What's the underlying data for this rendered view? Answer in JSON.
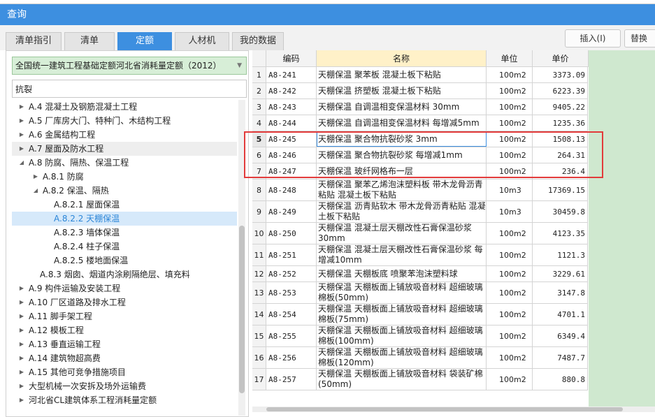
{
  "window": {
    "title": "查询"
  },
  "tabs": [
    {
      "label": "清单指引"
    },
    {
      "label": "清单"
    },
    {
      "label": "定额",
      "active": true
    },
    {
      "label": "人材机"
    },
    {
      "label": "我的数据"
    }
  ],
  "toolbar": {
    "insert_label": "插入(I)",
    "replace_label": "替换"
  },
  "library": {
    "selected": "全国统一建筑工程基础定额河北省消耗量定额（2012）"
  },
  "search": {
    "value": "抗裂"
  },
  "tree": [
    {
      "label": "A.4 混凝土及钢筋混凝土工程",
      "level": 1,
      "expander": "collapsed"
    },
    {
      "label": "A.5 厂库房大门、特种门、木结构工程",
      "level": 1,
      "expander": "collapsed"
    },
    {
      "label": "A.6 金属结构工程",
      "level": 1,
      "expander": "collapsed"
    },
    {
      "label": "A.7 屋面及防水工程",
      "level": 1,
      "expander": "collapsed",
      "state": "current"
    },
    {
      "label": "A.8 防腐、隔热、保温工程",
      "level": 1,
      "expander": "expanded"
    },
    {
      "label": "A.8.1 防腐",
      "level": 2,
      "expander": "collapsed"
    },
    {
      "label": "A.8.2 保温、隔热",
      "level": 2,
      "expander": "expanded"
    },
    {
      "label": "A.8.2.1 屋面保温",
      "level": 3,
      "expander": "none"
    },
    {
      "label": "A.8.2.2 天棚保温",
      "level": 3,
      "expander": "none",
      "state": "selected"
    },
    {
      "label": "A.8.2.3 墙体保温",
      "level": 3,
      "expander": "none"
    },
    {
      "label": "A.8.2.4 柱子保温",
      "level": 3,
      "expander": "none"
    },
    {
      "label": "A.8.2.5 楼地面保温",
      "level": 3,
      "expander": "none"
    },
    {
      "label": "A.8.3 烟囱、烟道内涂刷隔绝层、填充料",
      "level": 2,
      "expander": "none"
    },
    {
      "label": "A.9 构件运输及安装工程",
      "level": 1,
      "expander": "collapsed"
    },
    {
      "label": "A.10 厂区道路及排水工程",
      "level": 1,
      "expander": "collapsed"
    },
    {
      "label": "A.11 脚手架工程",
      "level": 1,
      "expander": "collapsed"
    },
    {
      "label": "A.12 模板工程",
      "level": 1,
      "expander": "collapsed"
    },
    {
      "label": "A.13 垂直运输工程",
      "level": 1,
      "expander": "collapsed"
    },
    {
      "label": "A.14 建筑物超高费",
      "level": 1,
      "expander": "collapsed"
    },
    {
      "label": "A.15 其他可竞争措施项目",
      "level": 1,
      "expander": "collapsed"
    },
    {
      "label": "大型机械一次安拆及场外运输费",
      "level": 1,
      "expander": "collapsed"
    },
    {
      "label": "河北省CL建筑体系工程消耗量定额",
      "level": 1,
      "expander": "collapsed"
    }
  ],
  "grid": {
    "columns": {
      "code": "编码",
      "name": "名称",
      "unit": "单位",
      "price": "单价"
    },
    "rows": [
      {
        "idx": "1",
        "code": "A8-241",
        "name": "天棚保温 聚苯板 混凝土板下粘贴",
        "unit": "100m2",
        "price": "3373.09"
      },
      {
        "idx": "2",
        "code": "A8-242",
        "name": "天棚保温 挤塑板 混凝土板下粘贴",
        "unit": "100m2",
        "price": "6223.39"
      },
      {
        "idx": "3",
        "code": "A8-243",
        "name": "天棚保温 自调温相变保温材料 30mm",
        "unit": "100m2",
        "price": "9405.22"
      },
      {
        "idx": "4",
        "code": "A8-244",
        "name": "天棚保温 自调温相变保温材料 每增减5mm",
        "unit": "100m2",
        "price": "1235.36"
      },
      {
        "idx": "5",
        "code": "A8-245",
        "name": "天棚保温 聚合物抗裂砂浆 3mm",
        "unit": "100m2",
        "price": "1508.13",
        "current": true
      },
      {
        "idx": "6",
        "code": "A8-246",
        "name": "天棚保温 聚合物抗裂砂浆 每增减1mm",
        "unit": "100m2",
        "price": "264.31"
      },
      {
        "idx": "7",
        "code": "A8-247",
        "name": "天棚保温 玻纤网格布一层",
        "unit": "100m2",
        "price": "236.4"
      },
      {
        "idx": "8",
        "code": "A8-248",
        "name": "天棚保温 聚苯乙烯泡沫塑料板 带木龙骨沥青粘贴 混凝土板下粘贴",
        "unit": "10m3",
        "price": "17369.15"
      },
      {
        "idx": "9",
        "code": "A8-249",
        "name": "天棚保温 沥青贴软木 带木龙骨沥青粘贴 混凝土板下粘贴",
        "unit": "10m3",
        "price": "30459.8"
      },
      {
        "idx": "10",
        "code": "A8-250",
        "name": "天棚保温 混凝土层天棚改性石膏保温砂浆 30mm",
        "unit": "100m2",
        "price": "4123.35"
      },
      {
        "idx": "11",
        "code": "A8-251",
        "name": "天棚保温 混凝土层天棚改性石膏保温砂浆 每增减10mm",
        "unit": "100m2",
        "price": "1121.3"
      },
      {
        "idx": "12",
        "code": "A8-252",
        "name": "天棚保温 天棚板底 喷聚苯泡沫塑料球",
        "unit": "100m2",
        "price": "3229.61"
      },
      {
        "idx": "13",
        "code": "A8-253",
        "name": "天棚保温 天棚板面上铺放吸音材料 超细玻璃棉板(50mm)",
        "unit": "100m2",
        "price": "3147.8"
      },
      {
        "idx": "14",
        "code": "A8-254",
        "name": "天棚保温 天棚板面上铺放吸音材料 超细玻璃棉板(75mm)",
        "unit": "100m2",
        "price": "4701.1"
      },
      {
        "idx": "15",
        "code": "A8-255",
        "name": "天棚保温 天棚板面上铺放吸音材料 超细玻璃棉板(100mm)",
        "unit": "100m2",
        "price": "6349.4"
      },
      {
        "idx": "16",
        "code": "A8-256",
        "name": "天棚保温 天棚板面上铺放吸音材料 超细玻璃棉板(120mm)",
        "unit": "100m2",
        "price": "7487.7"
      },
      {
        "idx": "17",
        "code": "A8-257",
        "name": "天棚保温 天棚板面上铺放吸音材料 袋装矿棉(50mm)",
        "unit": "100m2",
        "price": "880.8"
      }
    ]
  },
  "colors": {
    "accent": "#3d8fe0",
    "highlight_box": "#e23b3b",
    "library_bg": "#d7eed7",
    "name_header": "#fff1c8"
  }
}
